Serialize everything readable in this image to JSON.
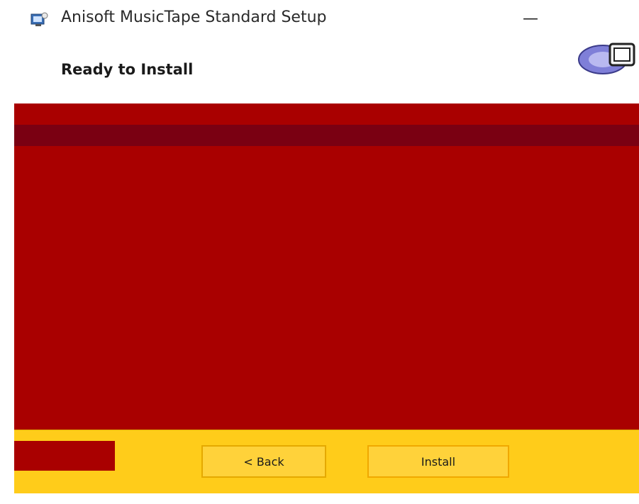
{
  "window": {
    "title": "Anisoft MusicTape Standard Setup",
    "minimize_glyph": "—",
    "close_glyph": "✕"
  },
  "header": {
    "heading": "Ready to Install",
    "logo_icon": "setup-logo-icon"
  },
  "content": {
    "info_line": "",
    "path_line": ""
  },
  "footer": {
    "back_label": "< Back",
    "install_label": "Install"
  },
  "colors": {
    "content_bg": "#a90000",
    "band": "#7a0012",
    "footer_bg": "#ffcc1a"
  }
}
